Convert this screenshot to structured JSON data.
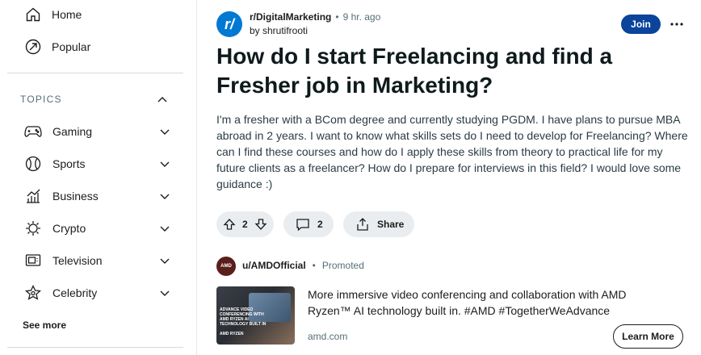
{
  "sidebar": {
    "nav": [
      {
        "label": "Home",
        "icon": "home-icon"
      },
      {
        "label": "Popular",
        "icon": "popular-icon"
      }
    ],
    "topics_heading": "TOPICS",
    "topics": [
      {
        "label": "Gaming",
        "icon": "gamepad-icon"
      },
      {
        "label": "Sports",
        "icon": "sports-ball-icon"
      },
      {
        "label": "Business",
        "icon": "chart-icon"
      },
      {
        "label": "Crypto",
        "icon": "crypto-icon"
      },
      {
        "label": "Television",
        "icon": "tv-icon"
      },
      {
        "label": "Celebrity",
        "icon": "star-icon"
      }
    ],
    "see_more": "See more"
  },
  "post": {
    "subreddit": "r/DigitalMarketing",
    "subreddit_icon_text": "r/",
    "separator": "•",
    "time": "9 hr. ago",
    "author": "by shrutifrooti",
    "join_label": "Join",
    "title": "How do I start Freelancing and find a Fresher job in Marketing?",
    "body": "I'm a fresher with a BCom degree and currently studying PGDM. I have plans to pursue MBA abroad in 2 years. I want to know what skills sets do I need to develop for Freelancing? Where can I find these courses and how do I apply these skills from theory to practical life for my future clients as a freelancer? How do I prepare for interviews in this field? I would love some guidance :)",
    "votes": "2",
    "comments": "2",
    "share_label": "Share"
  },
  "promoted": {
    "avatar_text": "AMD",
    "user": "u/AMDOfficial",
    "separator": "•",
    "tag": "Promoted",
    "thumb_text": "ADVANCE VIDEO CONFERENCING WITH AMD RYZEN AI TECHNOLOGY BUILT IN",
    "thumb_brand": "AMD RYZEN",
    "text": "More immersive video conferencing and collaboration with AMD Ryzen™ AI technology built in. #AMD #TogetherWeAdvance",
    "domain": "amd.com",
    "cta": "Learn More"
  },
  "colors": {
    "join_bg": "#0a449b",
    "subreddit_icon_bg": "#0079d3",
    "pill_bg": "#eaedef"
  }
}
